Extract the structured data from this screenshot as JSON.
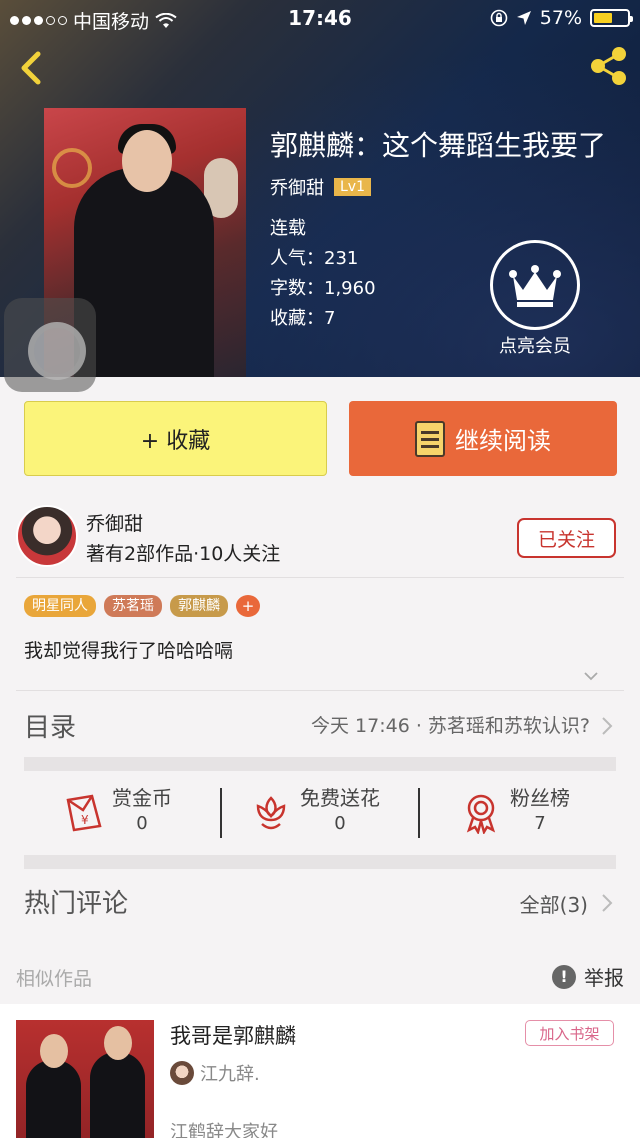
{
  "status_bar": {
    "carrier": "中国移动",
    "time": "17:46",
    "battery": "57%"
  },
  "book": {
    "title": "郭麒麟：这个舞蹈生我要了",
    "author": "乔御甜",
    "level": "Lv1",
    "status": "连载",
    "popularity": "人气：231",
    "word_count": "字数：1,960",
    "favorites": "收藏：7"
  },
  "vip": {
    "label": "点亮会员"
  },
  "actions": {
    "collect": "+ 收藏",
    "continue_read": "继续阅读"
  },
  "author_card": {
    "name": "乔御甜",
    "stats": "著有2部作品·10人关注",
    "follow": "已关注"
  },
  "tags": [
    {
      "label": "明星同人",
      "color": "#e9a63a"
    },
    {
      "label": "苏茗瑶",
      "color": "#cf7a58"
    },
    {
      "label": "郭麒麟",
      "color": "#c79a4a"
    }
  ],
  "tag_add": "+",
  "intro": "我却觉得我行了哈哈哈嗝",
  "catalog": {
    "label": "目录",
    "latest": "今天 17:46 · 苏茗瑶和苏软认识?"
  },
  "stats": [
    {
      "label": "赏金币",
      "value": "0",
      "icon": "coin-envelope-icon"
    },
    {
      "label": "免费送花",
      "value": "0",
      "icon": "flower-icon"
    },
    {
      "label": "粉丝榜",
      "value": "7",
      "icon": "medal-icon"
    }
  ],
  "hot_comments": {
    "label": "热门评论",
    "all": "全部(3)"
  },
  "similar": {
    "label": "相似作品",
    "report": "举报",
    "report_icon": "!",
    "card": {
      "title": "我哥是郭麒麟",
      "shelf": "加入书架",
      "author": "江九辞.",
      "desc": "江鹤辞大家好"
    }
  },
  "colors": {
    "accent_orange": "#e9683a",
    "collect_yellow": "#fbf47a",
    "follow_red": "#c8342e",
    "icon_red": "#c8342e"
  }
}
